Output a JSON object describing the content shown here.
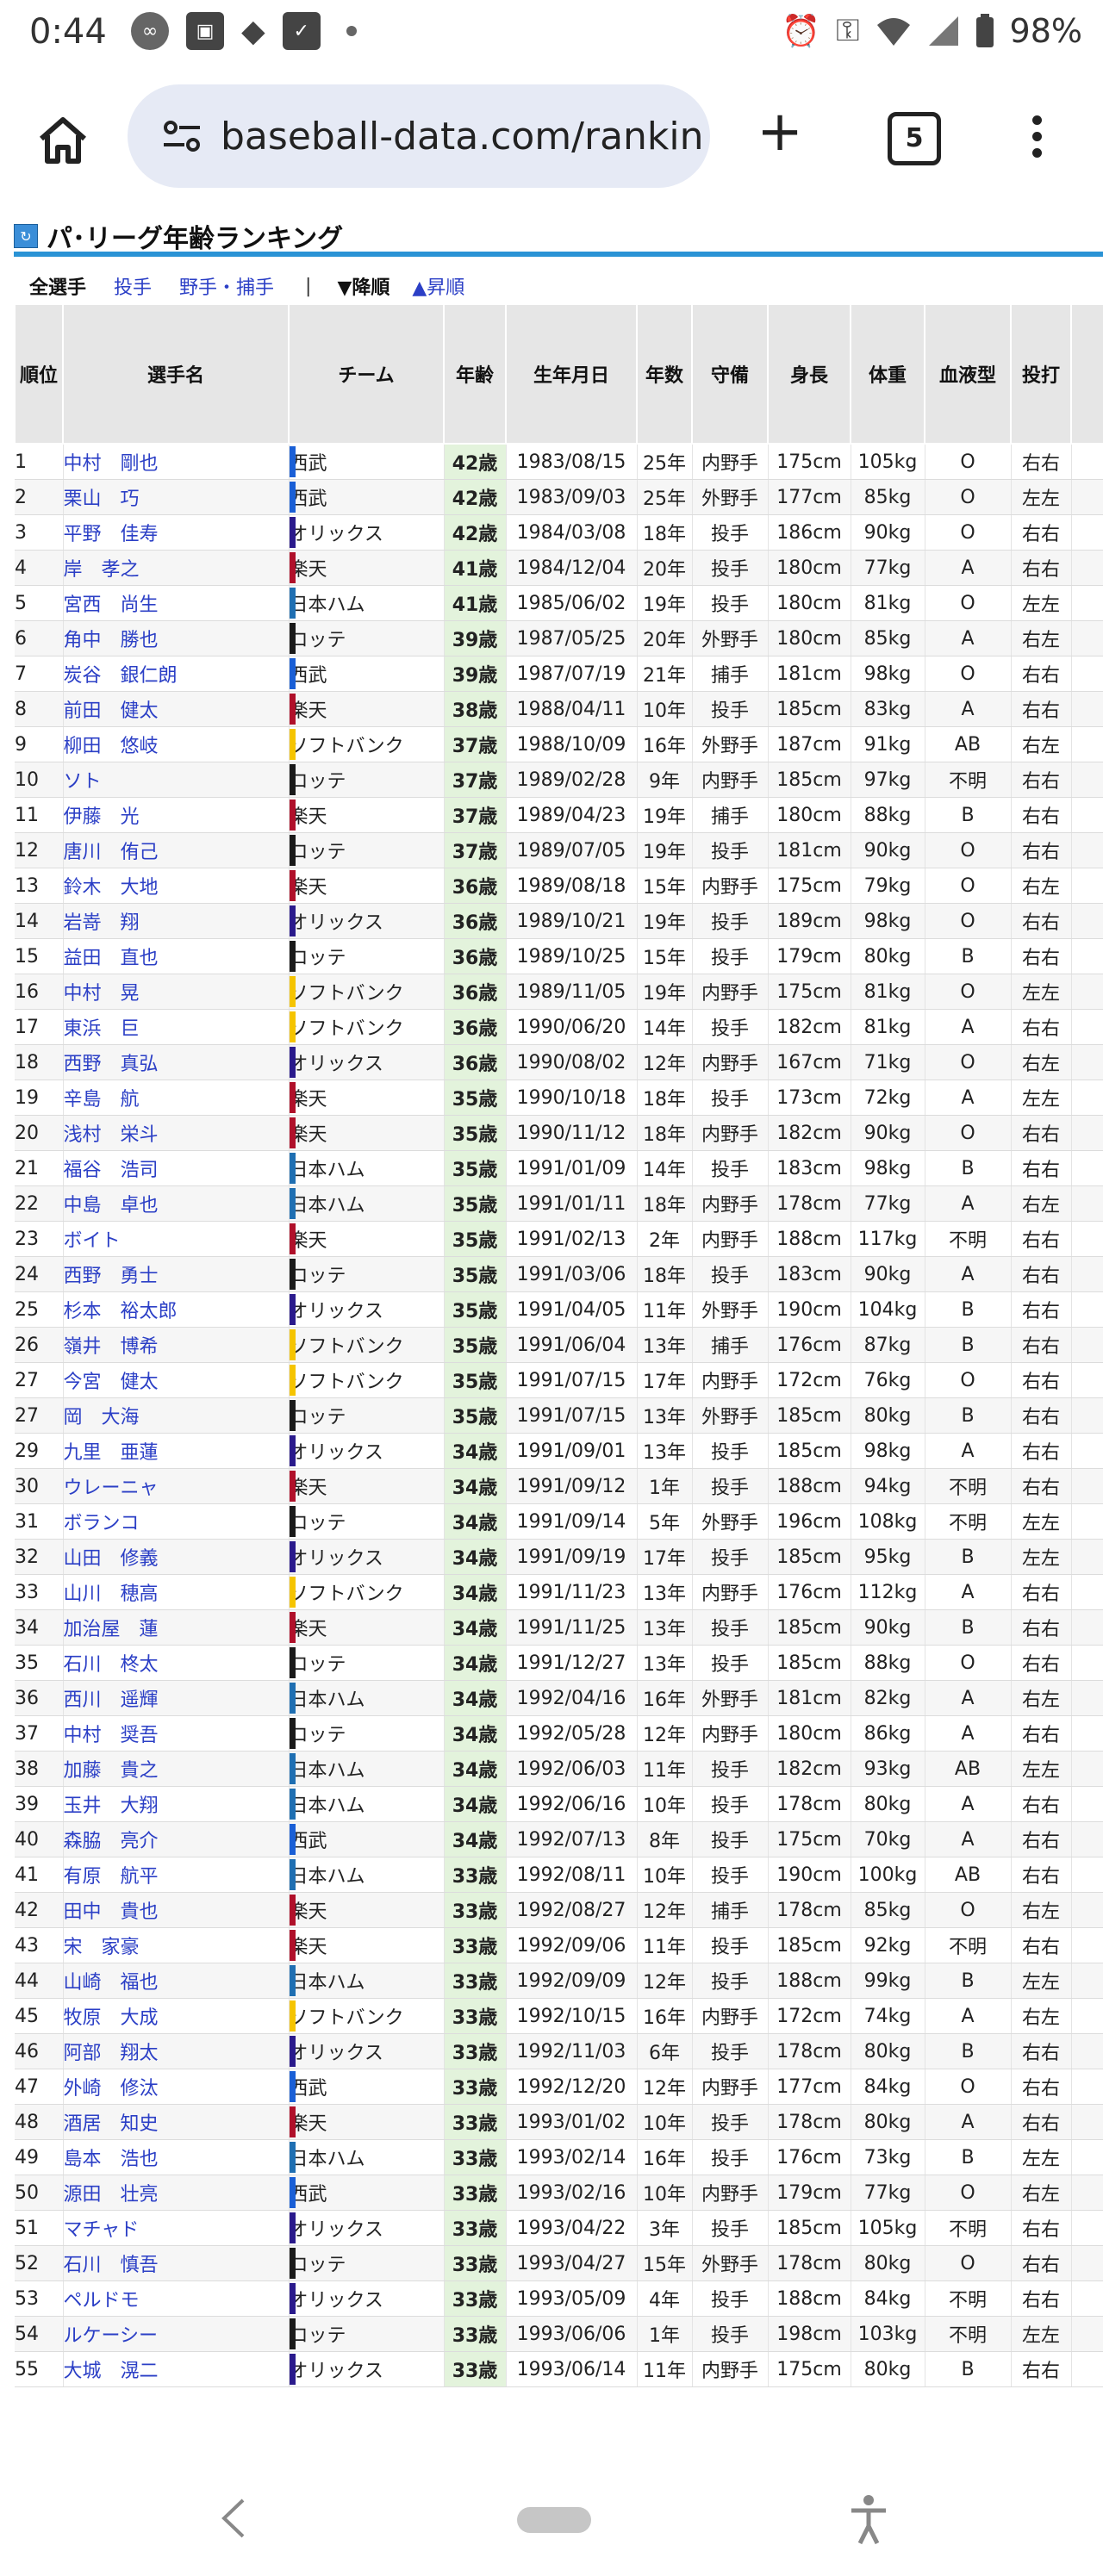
{
  "status": {
    "time": "0:44",
    "battery": "98%"
  },
  "browser": {
    "url": "baseball-data.com/rankin",
    "tab_count": "5"
  },
  "page": {
    "title": "パ･リーグ年齢ランキング",
    "filters": [
      "全選手",
      "投手",
      "野手・捕手"
    ],
    "separator": "|",
    "sort_desc": "▼降順",
    "sort_asc": "▲昇順"
  },
  "table": {
    "headers": [
      "順位",
      "選手名",
      "チーム",
      "年齢",
      "生年月日",
      "年数",
      "守備",
      "身長",
      "体重",
      "血液型",
      "投打"
    ],
    "rows": [
      [
        "1",
        "中村　剛也",
        "西武",
        "42歳",
        "1983/08/15",
        "25年",
        "内野手",
        "175cm",
        "105kg",
        "O",
        "右右"
      ],
      [
        "2",
        "栗山　巧",
        "西武",
        "42歳",
        "1983/09/03",
        "25年",
        "外野手",
        "177cm",
        "85kg",
        "O",
        "左左"
      ],
      [
        "3",
        "平野　佳寿",
        "オリックス",
        "42歳",
        "1984/03/08",
        "18年",
        "投手",
        "186cm",
        "90kg",
        "O",
        "右右"
      ],
      [
        "4",
        "岸　孝之",
        "楽天",
        "41歳",
        "1984/12/04",
        "20年",
        "投手",
        "180cm",
        "77kg",
        "A",
        "右右"
      ],
      [
        "5",
        "宮西　尚生",
        "日本ハム",
        "41歳",
        "1985/06/02",
        "19年",
        "投手",
        "180cm",
        "81kg",
        "O",
        "左左"
      ],
      [
        "6",
        "角中　勝也",
        "ロッテ",
        "39歳",
        "1987/05/25",
        "20年",
        "外野手",
        "180cm",
        "85kg",
        "A",
        "右左"
      ],
      [
        "7",
        "炭谷　銀仁朗",
        "西武",
        "39歳",
        "1987/07/19",
        "21年",
        "捕手",
        "181cm",
        "98kg",
        "O",
        "右右"
      ],
      [
        "8",
        "前田　健太",
        "楽天",
        "38歳",
        "1988/04/11",
        "10年",
        "投手",
        "185cm",
        "83kg",
        "A",
        "右右"
      ],
      [
        "9",
        "柳田　悠岐",
        "ソフトバンク",
        "37歳",
        "1988/10/09",
        "16年",
        "外野手",
        "187cm",
        "91kg",
        "AB",
        "右左"
      ],
      [
        "10",
        "ソト",
        "ロッテ",
        "37歳",
        "1989/02/28",
        "9年",
        "内野手",
        "185cm",
        "97kg",
        "不明",
        "右右"
      ],
      [
        "11",
        "伊藤　光",
        "楽天",
        "37歳",
        "1989/04/23",
        "19年",
        "捕手",
        "180cm",
        "88kg",
        "B",
        "右右"
      ],
      [
        "12",
        "唐川　侑己",
        "ロッテ",
        "37歳",
        "1989/07/05",
        "19年",
        "投手",
        "181cm",
        "90kg",
        "O",
        "右右"
      ],
      [
        "13",
        "鈴木　大地",
        "楽天",
        "36歳",
        "1989/08/18",
        "15年",
        "内野手",
        "175cm",
        "79kg",
        "O",
        "右左"
      ],
      [
        "14",
        "岩嵜　翔",
        "オリックス",
        "36歳",
        "1989/10/21",
        "19年",
        "投手",
        "189cm",
        "98kg",
        "O",
        "右右"
      ],
      [
        "15",
        "益田　直也",
        "ロッテ",
        "36歳",
        "1989/10/25",
        "15年",
        "投手",
        "179cm",
        "80kg",
        "B",
        "右右"
      ],
      [
        "16",
        "中村　晃",
        "ソフトバンク",
        "36歳",
        "1989/11/05",
        "19年",
        "内野手",
        "175cm",
        "81kg",
        "O",
        "左左"
      ],
      [
        "17",
        "東浜　巨",
        "ソフトバンク",
        "36歳",
        "1990/06/20",
        "14年",
        "投手",
        "182cm",
        "81kg",
        "A",
        "右右"
      ],
      [
        "18",
        "西野　真弘",
        "オリックス",
        "36歳",
        "1990/08/02",
        "12年",
        "内野手",
        "167cm",
        "71kg",
        "O",
        "右左"
      ],
      [
        "19",
        "辛島　航",
        "楽天",
        "35歳",
        "1990/10/18",
        "18年",
        "投手",
        "173cm",
        "72kg",
        "A",
        "左左"
      ],
      [
        "20",
        "浅村　栄斗",
        "楽天",
        "35歳",
        "1990/11/12",
        "18年",
        "内野手",
        "182cm",
        "90kg",
        "O",
        "右右"
      ],
      [
        "21",
        "福谷　浩司",
        "日本ハム",
        "35歳",
        "1991/01/09",
        "14年",
        "投手",
        "183cm",
        "98kg",
        "B",
        "右右"
      ],
      [
        "22",
        "中島　卓也",
        "日本ハム",
        "35歳",
        "1991/01/11",
        "18年",
        "内野手",
        "178cm",
        "77kg",
        "A",
        "右左"
      ],
      [
        "23",
        "ボイト",
        "楽天",
        "35歳",
        "1991/02/13",
        "2年",
        "内野手",
        "188cm",
        "117kg",
        "不明",
        "右右"
      ],
      [
        "24",
        "西野　勇士",
        "ロッテ",
        "35歳",
        "1991/03/06",
        "18年",
        "投手",
        "183cm",
        "90kg",
        "A",
        "右右"
      ],
      [
        "25",
        "杉本　裕太郎",
        "オリックス",
        "35歳",
        "1991/04/05",
        "11年",
        "外野手",
        "190cm",
        "104kg",
        "B",
        "右右"
      ],
      [
        "26",
        "嶺井　博希",
        "ソフトバンク",
        "35歳",
        "1991/06/04",
        "13年",
        "捕手",
        "176cm",
        "87kg",
        "B",
        "右右"
      ],
      [
        "27",
        "今宮　健太",
        "ソフトバンク",
        "35歳",
        "1991/07/15",
        "17年",
        "内野手",
        "172cm",
        "76kg",
        "O",
        "右右"
      ],
      [
        "27",
        "岡　大海",
        "ロッテ",
        "35歳",
        "1991/07/15",
        "13年",
        "外野手",
        "185cm",
        "80kg",
        "B",
        "右右"
      ],
      [
        "29",
        "九里　亜蓮",
        "オリックス",
        "34歳",
        "1991/09/01",
        "13年",
        "投手",
        "185cm",
        "98kg",
        "A",
        "右右"
      ],
      [
        "30",
        "ウレーニャ",
        "楽天",
        "34歳",
        "1991/09/12",
        "1年",
        "投手",
        "188cm",
        "94kg",
        "不明",
        "右右"
      ],
      [
        "31",
        "ボランコ",
        "ロッテ",
        "34歳",
        "1991/09/14",
        "5年",
        "外野手",
        "196cm",
        "108kg",
        "不明",
        "左左"
      ],
      [
        "32",
        "山田　修義",
        "オリックス",
        "34歳",
        "1991/09/19",
        "17年",
        "投手",
        "185cm",
        "95kg",
        "B",
        "左左"
      ],
      [
        "33",
        "山川　穂高",
        "ソフトバンク",
        "34歳",
        "1991/11/23",
        "13年",
        "内野手",
        "176cm",
        "112kg",
        "A",
        "右右"
      ],
      [
        "34",
        "加治屋　蓮",
        "楽天",
        "34歳",
        "1991/11/25",
        "13年",
        "投手",
        "185cm",
        "90kg",
        "B",
        "右右"
      ],
      [
        "35",
        "石川　柊太",
        "ロッテ",
        "34歳",
        "1991/12/27",
        "13年",
        "投手",
        "185cm",
        "88kg",
        "O",
        "右右"
      ],
      [
        "36",
        "西川　遥輝",
        "日本ハム",
        "34歳",
        "1992/04/16",
        "16年",
        "外野手",
        "181cm",
        "82kg",
        "A",
        "右左"
      ],
      [
        "37",
        "中村　奨吾",
        "ロッテ",
        "34歳",
        "1992/05/28",
        "12年",
        "内野手",
        "180cm",
        "86kg",
        "A",
        "右右"
      ],
      [
        "38",
        "加藤　貴之",
        "日本ハム",
        "34歳",
        "1992/06/03",
        "11年",
        "投手",
        "182cm",
        "93kg",
        "AB",
        "左左"
      ],
      [
        "39",
        "玉井　大翔",
        "日本ハム",
        "34歳",
        "1992/06/16",
        "10年",
        "投手",
        "178cm",
        "80kg",
        "A",
        "右右"
      ],
      [
        "40",
        "森脇　亮介",
        "西武",
        "34歳",
        "1992/07/13",
        "8年",
        "投手",
        "175cm",
        "70kg",
        "A",
        "右右"
      ],
      [
        "41",
        "有原　航平",
        "日本ハム",
        "33歳",
        "1992/08/11",
        "10年",
        "投手",
        "190cm",
        "100kg",
        "AB",
        "右右"
      ],
      [
        "42",
        "田中　貴也",
        "楽天",
        "33歳",
        "1992/08/27",
        "12年",
        "捕手",
        "178cm",
        "85kg",
        "O",
        "右左"
      ],
      [
        "43",
        "宋　家豪",
        "楽天",
        "33歳",
        "1992/09/06",
        "11年",
        "投手",
        "185cm",
        "92kg",
        "不明",
        "右右"
      ],
      [
        "44",
        "山崎　福也",
        "日本ハム",
        "33歳",
        "1992/09/09",
        "12年",
        "投手",
        "188cm",
        "99kg",
        "B",
        "左左"
      ],
      [
        "45",
        "牧原　大成",
        "ソフトバンク",
        "33歳",
        "1992/10/15",
        "16年",
        "内野手",
        "172cm",
        "74kg",
        "A",
        "右左"
      ],
      [
        "46",
        "阿部　翔太",
        "オリックス",
        "33歳",
        "1992/11/03",
        "6年",
        "投手",
        "178cm",
        "80kg",
        "B",
        "右右"
      ],
      [
        "47",
        "外崎　修汰",
        "西武",
        "33歳",
        "1992/12/20",
        "12年",
        "内野手",
        "177cm",
        "84kg",
        "O",
        "右右"
      ],
      [
        "48",
        "酒居　知史",
        "楽天",
        "33歳",
        "1993/01/02",
        "10年",
        "投手",
        "178cm",
        "80kg",
        "A",
        "右右"
      ],
      [
        "49",
        "島本　浩也",
        "日本ハム",
        "33歳",
        "1993/02/14",
        "16年",
        "投手",
        "176cm",
        "73kg",
        "B",
        "左左"
      ],
      [
        "50",
        "源田　壮亮",
        "西武",
        "33歳",
        "1993/02/16",
        "10年",
        "内野手",
        "179cm",
        "77kg",
        "O",
        "右左"
      ],
      [
        "51",
        "マチャド",
        "オリックス",
        "33歳",
        "1993/04/22",
        "3年",
        "投手",
        "185cm",
        "105kg",
        "不明",
        "右右"
      ],
      [
        "52",
        "石川　慎吾",
        "ロッテ",
        "33歳",
        "1993/04/27",
        "15年",
        "外野手",
        "178cm",
        "80kg",
        "O",
        "右右"
      ],
      [
        "53",
        "ペルドモ",
        "オリックス",
        "33歳",
        "1993/05/09",
        "4年",
        "投手",
        "188cm",
        "84kg",
        "不明",
        "右右"
      ],
      [
        "54",
        "ルケーシー",
        "ロッテ",
        "33歳",
        "1993/06/06",
        "1年",
        "投手",
        "198cm",
        "103kg",
        "不明",
        "左左"
      ],
      [
        "55",
        "大城　滉二",
        "オリックス",
        "33歳",
        "1993/06/14",
        "11年",
        "内野手",
        "175cm",
        "80kg",
        "B",
        "右右"
      ]
    ]
  },
  "team_colors": {
    "西武": "#1a5fd6",
    "オリックス": "#2a1a8c",
    "楽天": "#b0102a",
    "日本ハム": "#1f6fb2",
    "ロッテ": "#1a1a1a",
    "ソフトバンク": "#f5c400"
  },
  "icons": {
    "home": "home-icon",
    "tune": "tune-icon",
    "plus": "plus-icon",
    "menu": "more-vert-icon"
  }
}
